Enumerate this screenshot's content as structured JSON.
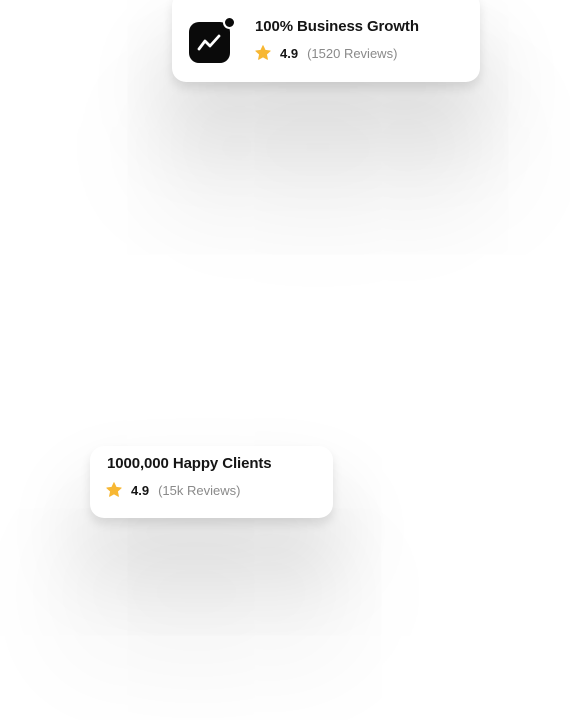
{
  "growth_card": {
    "icon": "trending-up-icon",
    "title": "100% Business Growth",
    "rating": "4.9",
    "reviews": "(1520 Reviews)"
  },
  "clients_card": {
    "title": "1000,000 Happy Clients",
    "rating": "4.9",
    "reviews": "(15k Reviews)"
  },
  "colors": {
    "star": "#F7B733",
    "icon_bg": "#0A0A0A",
    "title_text": "#151515",
    "muted_text": "#8A8A8A"
  }
}
